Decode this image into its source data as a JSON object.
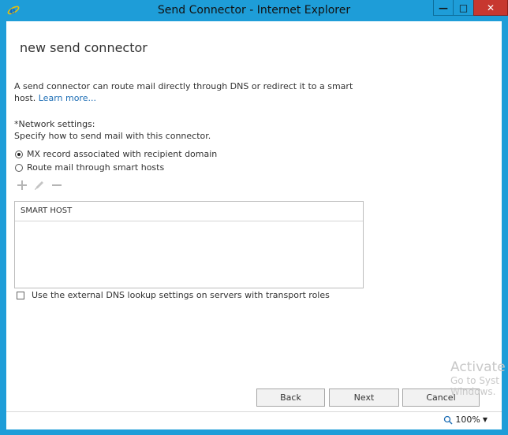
{
  "window": {
    "title": "Send Connector - Internet Explorer",
    "min_glyph": "—",
    "max_glyph": "□",
    "close_glyph": "✕"
  },
  "page": {
    "heading": "new send connector",
    "description": "A send connector can route mail directly through DNS or redirect it to a smart host.",
    "learn_more": "Learn more...",
    "network_label": "*Network settings:",
    "network_sub": "Specify how to send mail with this connector.",
    "radio_mx": "MX record associated with recipient domain",
    "radio_smart": "Route mail through smart hosts",
    "grid_header": "SMART HOST",
    "checkbox_label": "Use the external DNS lookup settings on servers with transport roles"
  },
  "buttons": {
    "back": "Back",
    "next": "Next",
    "cancel": "Cancel"
  },
  "status": {
    "zoom": "100%"
  },
  "watermark": {
    "line1": "Activate",
    "line2": "Go to Syst",
    "line3": "Windows."
  },
  "colors": {
    "frame": "#1e9dd8",
    "close": "#c7372f",
    "link": "#1e6eb5"
  }
}
